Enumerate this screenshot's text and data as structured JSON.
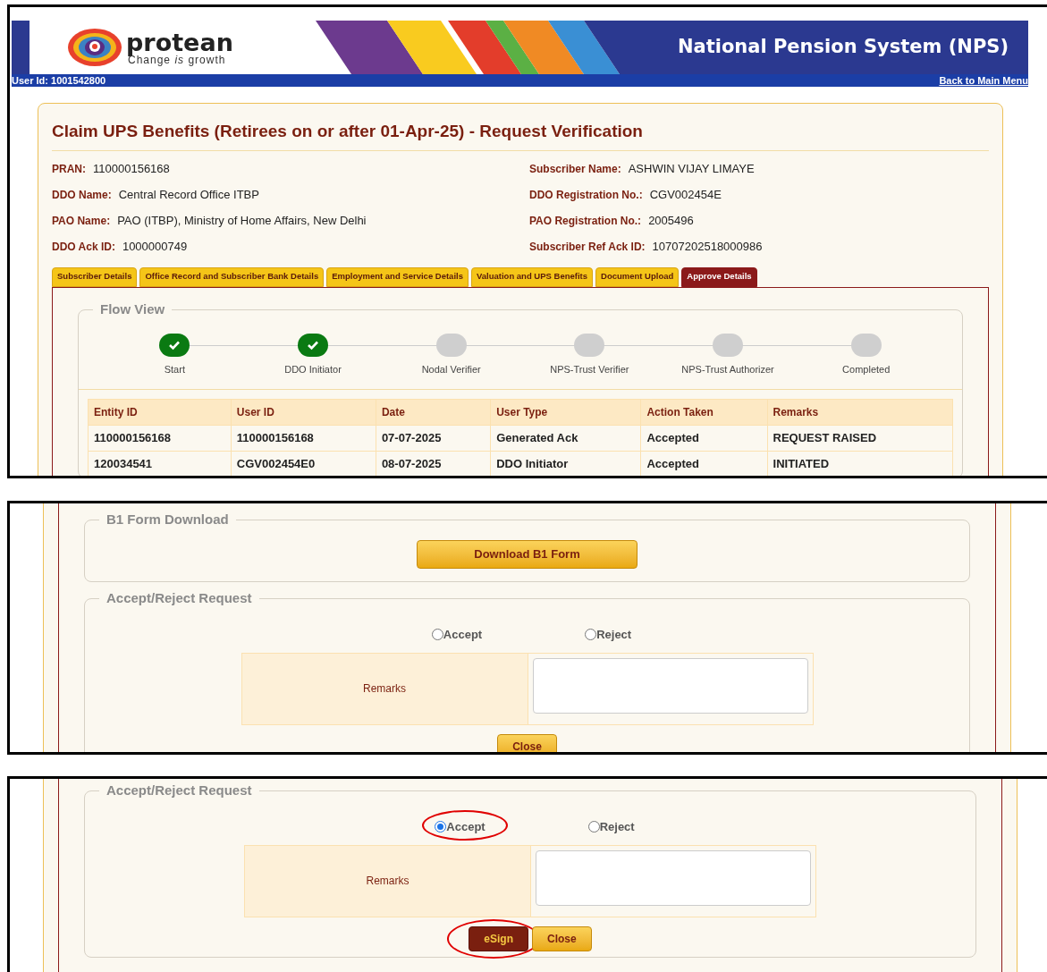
{
  "header": {
    "logo_name": "protean",
    "tagline": "Change *is* growth",
    "title": "National Pension System (NPS)",
    "user_id": "User Id: 1001542800",
    "back_link": "Back to Main Menu"
  },
  "page_title": "Claim UPS Benefits (Retirees on or after 01-Apr-25) - Request Verification",
  "fields": [
    {
      "label": "PRAN:",
      "value": "110000156168"
    },
    {
      "label": "Subscriber Name:",
      "value": "ASHWIN VIJAY LIMAYE"
    },
    {
      "label": "DDO Name:",
      "value": "Central Record Office ITBP"
    },
    {
      "label": "DDO Registration No.:",
      "value": "CGV002454E"
    },
    {
      "label": "PAO Name:",
      "value": "PAO (ITBP), Ministry of Home Affairs, New Delhi"
    },
    {
      "label": "PAO Registration No.:",
      "value": "2005496"
    },
    {
      "label": "DDO Ack ID:",
      "value": "1000000749"
    },
    {
      "label": "Subscriber Ref Ack ID:",
      "value": "10707202518000986"
    }
  ],
  "tabs": [
    {
      "label": "Subscriber Details",
      "selected": false
    },
    {
      "label": "Office Record and Subscriber Bank Details",
      "selected": false
    },
    {
      "label": "Employment and Service Details",
      "selected": false
    },
    {
      "label": "Valuation and UPS Benefits",
      "selected": false
    },
    {
      "label": "Document Upload",
      "selected": false
    },
    {
      "label": "Approve Details",
      "selected": true
    }
  ],
  "flow_view": {
    "title": "Flow View",
    "steps": [
      {
        "label": "Start",
        "done": true
      },
      {
        "label": "DDO Initiator",
        "done": true
      },
      {
        "label": "Nodal Verifier",
        "done": false
      },
      {
        "label": "NPS-Trust Verifier",
        "done": false
      },
      {
        "label": "NPS-Trust Authorizer",
        "done": false
      },
      {
        "label": "Completed",
        "done": false
      }
    ]
  },
  "history_table": {
    "columns": [
      "Entity ID",
      "User ID",
      "Date",
      "User Type",
      "Action Taken",
      "Remarks"
    ],
    "rows": [
      [
        "110000156168",
        "110000156168",
        "07-07-2025",
        "Generated Ack",
        "Accepted",
        "REQUEST RAISED"
      ],
      [
        "120034541",
        "CGV002454E0",
        "08-07-2025",
        "DDO Initiator",
        "Accepted",
        "INITIATED"
      ]
    ]
  },
  "b1_download": {
    "title": "B1 Form Download",
    "button": "Download B1 Form"
  },
  "requests": [
    {
      "title": "Accept/Reject Request",
      "options": [
        {
          "label": "Accept",
          "selected": false,
          "circled": false
        },
        {
          "label": "Reject",
          "selected": false,
          "circled": false
        }
      ],
      "remarks_label": "Remarks",
      "buttons": [
        {
          "label": "Close",
          "kind": "close",
          "circled": false
        }
      ]
    },
    {
      "title": "Accept/Reject Request",
      "options": [
        {
          "label": "Accept",
          "selected": true,
          "circled": true
        },
        {
          "label": "Reject",
          "selected": false,
          "circled": false
        }
      ],
      "remarks_label": "Remarks",
      "buttons": [
        {
          "label": "eSign",
          "kind": "esign",
          "circled": true
        },
        {
          "label": "Close",
          "kind": "close",
          "circled": false
        }
      ]
    }
  ]
}
